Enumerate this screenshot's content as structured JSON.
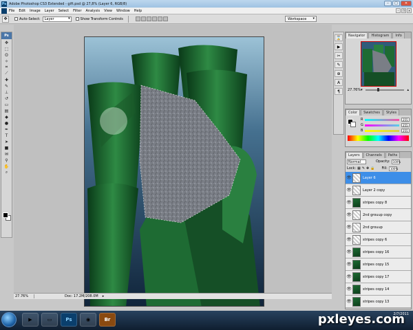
{
  "app": {
    "title": "Adobe Photoshop CS3 Extended - gift.psd @ 27,8% (Layer 6, RGB/8)",
    "logo": "Ps"
  },
  "menu": [
    "File",
    "Edit",
    "Image",
    "Layer",
    "Select",
    "Filter",
    "Analysis",
    "View",
    "Window",
    "Help"
  ],
  "options": {
    "auto_select_label": "Auto-Select:",
    "auto_select_value": "Layer",
    "transform_label": "Show Transform Controls",
    "workspace": "Workspace"
  },
  "tools": {
    "header": "Ps",
    "icons": [
      "move-icon",
      "marquee-icon",
      "lasso-icon",
      "magic-wand-icon",
      "crop-icon",
      "slice-icon",
      "healing-icon",
      "brush-icon",
      "stamp-icon",
      "history-brush-icon",
      "eraser-icon",
      "gradient-icon",
      "blur-icon",
      "dodge-icon",
      "pen-icon",
      "type-icon",
      "path-select-icon",
      "shape-icon",
      "notes-icon",
      "eyedropper-icon",
      "hand-icon",
      "zoom-icon"
    ]
  },
  "status": {
    "zoom": "27.76%",
    "doc": "Doc: 17.2M/208.0M"
  },
  "navigator": {
    "tabs": [
      "Navigator",
      "Histogram",
      "Info"
    ],
    "zoom": "27.76%"
  },
  "color": {
    "tabs": [
      "Color",
      "Swatches",
      "Styles"
    ],
    "channels": [
      {
        "label": "R",
        "value": "255",
        "color": "#ff4da6"
      },
      {
        "label": "G",
        "value": "255",
        "color": "#55d4e6"
      },
      {
        "label": "B",
        "value": "255",
        "color": "#d6d24a"
      }
    ]
  },
  "layers": {
    "tabs": [
      "Layers",
      "Channels",
      "Paths"
    ],
    "blend_mode": "Normal",
    "opacity_label": "Opacity:",
    "opacity": "100%",
    "lock_label": "Lock:",
    "fill_label": "Fill:",
    "fill": "100%",
    "items": [
      {
        "name": "Layer 6",
        "selected": true,
        "thumb": "checker"
      },
      {
        "name": "Layer 2 copy",
        "selected": false,
        "thumb": "checker"
      },
      {
        "name": "stripes copy 8",
        "selected": false,
        "thumb": "green"
      },
      {
        "name": "2nd grouup copy",
        "selected": false,
        "thumb": "checker"
      },
      {
        "name": "2nd grouup",
        "selected": false,
        "thumb": "checker"
      },
      {
        "name": "stripes copy 6",
        "selected": false,
        "thumb": "checker"
      },
      {
        "name": "stripes copy 16",
        "selected": false,
        "thumb": "green"
      },
      {
        "name": "stripes copy 15",
        "selected": false,
        "thumb": "green"
      },
      {
        "name": "stripes copy 17",
        "selected": false,
        "thumb": "green"
      },
      {
        "name": "stripes copy 14",
        "selected": false,
        "thumb": "green"
      },
      {
        "name": "stripes copy 13",
        "selected": false,
        "thumb": "green"
      }
    ]
  },
  "taskbar": {
    "items": [
      "Ps",
      "Br"
    ],
    "time": "",
    "date": "2/7/2011"
  },
  "watermark": "pxleyes.com"
}
